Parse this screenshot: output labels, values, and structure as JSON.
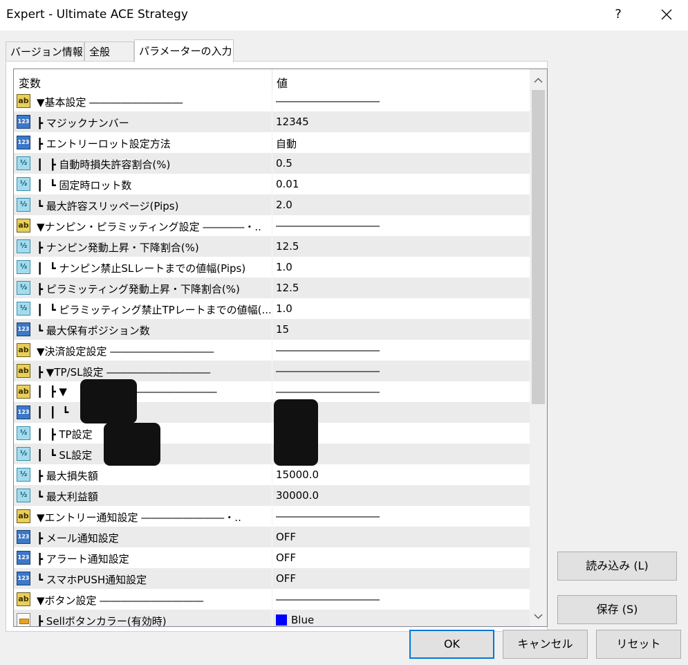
{
  "window": {
    "title": "Expert - Ultimate ACE Strategy",
    "help": "?"
  },
  "tabs": [
    {
      "label": "バージョン情報"
    },
    {
      "label": "全般"
    },
    {
      "label": "パラメーターの入力"
    }
  ],
  "table": {
    "col_name": "変数",
    "col_value": "値",
    "rows": [
      {
        "icon": "ab-string-icon",
        "name": "▼基本設定 ―――――――――",
        "value": "――――――――――"
      },
      {
        "icon": "integer-123-icon",
        "name": "┣ マジックナンバー",
        "value": "12345"
      },
      {
        "icon": "integer-123-icon",
        "name": "┣ エントリーロット設定方法",
        "value": "自動"
      },
      {
        "icon": "double-half-icon",
        "name": "┃  ┣ 自動時損失許容割合(%)",
        "value": "0.5"
      },
      {
        "icon": "double-half-icon",
        "name": "┃  ┗ 固定時ロット数",
        "value": "0.01"
      },
      {
        "icon": "double-half-icon",
        "name": "┗ 最大許容スリッページ(Pips)",
        "value": "2.0"
      },
      {
        "icon": "ab-string-icon",
        "name": "▼ナンピン・ピラミッティング設定 ――――・..",
        "value": "――――――――――"
      },
      {
        "icon": "double-half-icon",
        "name": "┣ ナンピン発動上昇・下降割合(%)",
        "value": "12.5"
      },
      {
        "icon": "double-half-icon",
        "name": "┃  ┗ ナンピン禁止SLレートまでの値幅(Pips)",
        "value": "1.0"
      },
      {
        "icon": "double-half-icon",
        "name": "┣ ピラミッティング発動上昇・下降割合(%)",
        "value": "12.5"
      },
      {
        "icon": "double-half-icon",
        "name": "┃  ┗ ピラミッティング禁止TPレートまでの値幅(...",
        "value": "1.0"
      },
      {
        "icon": "integer-123-icon",
        "name": "┗ 最大保有ポジション数",
        "value": "15"
      },
      {
        "icon": "ab-string-icon",
        "name": "▼決済設定設定 ――――――――――",
        "value": "――――――――――"
      },
      {
        "icon": "ab-string-icon",
        "name": "┣ ▼TP/SL設定 ――――――――――",
        "value": "――――――――――"
      },
      {
        "icon": "ab-string-icon",
        "name": "┃  ┣ ▼              ――――――――――",
        "value": "――――――――――"
      },
      {
        "icon": "integer-123-icon",
        "name": "┃  ┃  ┗",
        "value": ""
      },
      {
        "icon": "double-half-icon",
        "name": "┃  ┣ TP設定",
        "value": ""
      },
      {
        "icon": "double-half-icon",
        "name": "┃  ┗ SL設定",
        "value": ""
      },
      {
        "icon": "double-half-icon",
        "name": "┣ 最大損失額",
        "value": "15000.0"
      },
      {
        "icon": "double-half-icon",
        "name": "┗ 最大利益額",
        "value": "30000.0"
      },
      {
        "icon": "ab-string-icon",
        "name": "▼エントリー通知設定 ――――――――・..",
        "value": "――――――――――"
      },
      {
        "icon": "integer-123-icon",
        "name": "┣ メール通知設定",
        "value": "OFF"
      },
      {
        "icon": "integer-123-icon",
        "name": "┣ アラート通知設定",
        "value": "OFF"
      },
      {
        "icon": "integer-123-icon",
        "name": "┗ スマホPUSH通知設定",
        "value": "OFF"
      },
      {
        "icon": "ab-string-icon",
        "name": "▼ボタン設定 ――――――――――",
        "value": "――――――――――"
      },
      {
        "icon": "color-icon",
        "name": "┣ Sellボタンカラー(有効時)",
        "value": "Blue",
        "swatch": "#0000ff"
      }
    ]
  },
  "buttons": {
    "load": "読み込み (L)",
    "save": "保存 (S)",
    "ok": "OK",
    "cancel": "キャンセル",
    "reset": "リセット"
  },
  "colors": {
    "accent": "#0078d7",
    "row_alt": "#ebebeb",
    "swatch_blue": "#0000ff"
  }
}
